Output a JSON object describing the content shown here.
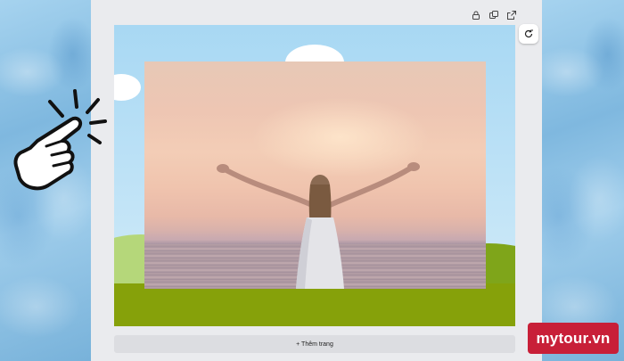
{
  "editor": {
    "toolbar": {
      "icons": [
        "lock-icon",
        "duplicate-icon",
        "share-icon"
      ]
    },
    "refresh_icon": "refresh-icon",
    "add_page_label": "+ Thêm trang"
  },
  "overlay": {
    "hand_icon": "pointing-hand-icon",
    "watermark": "mytour.vn"
  },
  "colors": {
    "ground": "#86a10a",
    "sky": "#a8d8f3",
    "badge": "#c81f38",
    "workspace": "#eaebee"
  }
}
